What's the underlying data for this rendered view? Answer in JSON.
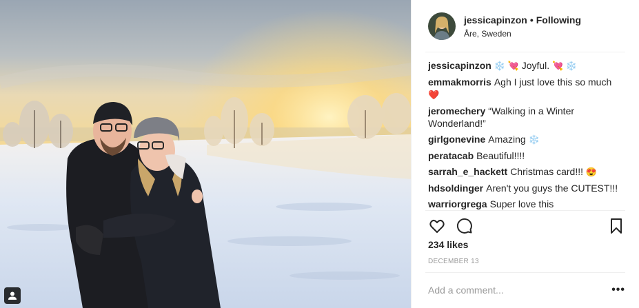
{
  "post": {
    "username": "jessicapinzon",
    "separator": "•",
    "follow_status": "Following",
    "location": "Åre, Sweden"
  },
  "comments": [
    {
      "user": "jessicapinzon",
      "pre": "❄️ 💘",
      "text": "Joyful.",
      "post": "💘 ❄️"
    },
    {
      "user": "emmakmorris",
      "pre": "",
      "text": "Agh I just love this so much",
      "post": "❤️"
    },
    {
      "user": "jeromechery",
      "pre": "",
      "text": "“Walking in a Winter Wonderland!”",
      "post": ""
    },
    {
      "user": "girlgonevine",
      "pre": "",
      "text": "Amazing",
      "post": "❄️"
    },
    {
      "user": "peratacab",
      "pre": "",
      "text": "Beautiful!!!!",
      "post": ""
    },
    {
      "user": "sarrah_e_hackett",
      "pre": "",
      "text": "Christmas card!!!",
      "post": "😍"
    },
    {
      "user": "hdsoldinger",
      "pre": "",
      "text": "Aren't you guys the CUTEST!!!",
      "post": ""
    },
    {
      "user": "warriorgrega",
      "pre": "",
      "text": "Super love this",
      "post": ""
    }
  ],
  "likes": "234 likes",
  "date": "DECEMBER 13",
  "add_comment": {
    "placeholder": "Add a comment..."
  },
  "more_label": "•••",
  "icons": {
    "like": "heart-icon",
    "comment": "comment-icon",
    "save": "bookmark-icon",
    "tag": "user-tag-icon"
  }
}
